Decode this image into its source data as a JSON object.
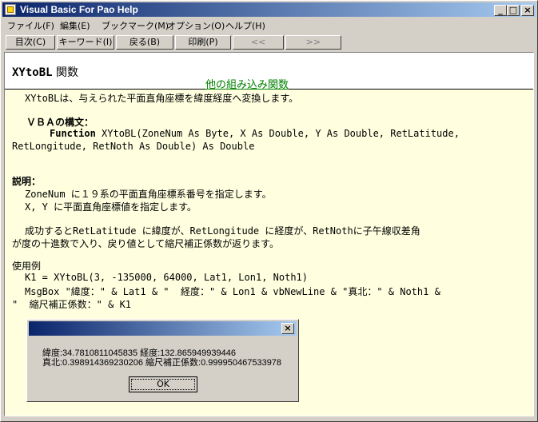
{
  "window": {
    "title": "Visual Basic For Pao Help"
  },
  "controls": {
    "minimize": "_",
    "maximize": "□",
    "close": "×"
  },
  "menu": [
    "ファイル(F)",
    "編集(E)",
    "ブックマーク(M)",
    "オプション(O)",
    "ヘルプ(H)"
  ],
  "toolbar": [
    "目次(C)",
    "キーワード(I)",
    "戻る(B)",
    "印刷(P)",
    "<<",
    ">>"
  ],
  "topic": {
    "name": "XYtoBL",
    "suffix": " 関数",
    "link": "他の組み込み関数"
  },
  "body": {
    "intro": "XYtoBLは、与えられた平面直角座標を緯度経度へ変換します。",
    "syntax_heading": "ＶＢＡの構文：",
    "syntax_keyword": "Function",
    "syntax_line1": " XYtoBL(ZoneNum As Byte, X As Double, Y As Double, RetLatitude,",
    "syntax_line2": "RetLongitude, RetNoth As Double) As Double",
    "desc_heading": "説明：",
    "desc_line1": "ZoneNum に１９系の平面直角座標系番号を指定します。",
    "desc_line2": "X, Y に平面直角座標値を指定します。",
    "desc_line3": "成功するとRetLatitude に緯度が、RetLongitude に経度が、RetNothに子午線収差角",
    "desc_line4": "が度の十進数で入り、戻り値として縮尺補正係数が返ります。",
    "example_heading": "使用例",
    "example_line1": "K1 = XYtoBL(3, -135000, 64000, Lat1, Lon1, Noth1)",
    "example_line2": "MsgBox \"緯度：\" & Lat1 & \"  経度：\" & Lon1 & vbNewLine & \"真北：\" & Noth1 &",
    "example_line3": "\"  縮尺補正係数：\" & K1"
  },
  "dialog": {
    "close": "×",
    "line1": "緯度:34.7810811045835  経度:132.865949939446",
    "line2": "真北:0.398914369230206  縮尺補正係数:0.999950467533978",
    "ok": "OK"
  }
}
